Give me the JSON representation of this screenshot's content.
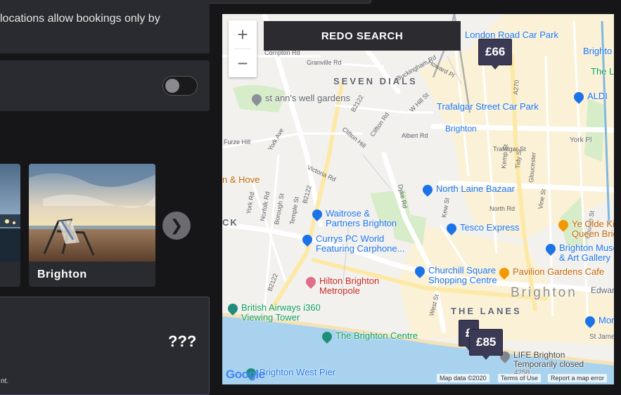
{
  "notice": {
    "text": "locations allow bookings only by"
  },
  "cards": {
    "main_label": "Brighton",
    "next_label": "❯"
  },
  "price_panel": {
    "price": "???",
    "footnote": "nt."
  },
  "map": {
    "redo_label": "REDO SEARCH",
    "zoom_in": "+",
    "zoom_out": "−",
    "pins": [
      "£66",
      "£",
      "£85"
    ],
    "labels": {
      "seven_dials": "SEVEN DIALS",
      "st_anns": "st ann's well gardens",
      "london_road": "London Road Car Park",
      "trafalgar_park": "Trafalgar Street Car Park",
      "brighton_station": "Brighton",
      "north_laine": "North Laine Bazaar",
      "waitrose": "Waitrose &\nPartners Brighton",
      "tesco": "Tesco Express",
      "currys": "Currys PC World\nFeaturing Carphone...",
      "churchill": "Churchill Square\nShopping Centre",
      "hilton": "Hilton Brighton\nMetropole",
      "ba_i360": "British Airways i360\nViewing Tower",
      "brighton_centre": "The Brighton Centre",
      "the_lanes": "THE LANES",
      "brighton_big": "Brighton",
      "museum": "Brighton Museum\n& Art Gallery",
      "ye_olde": "Ye Olde King\nQueen Brigh",
      "pavilion_cafe": "Pavilion Gardens Cafe",
      "hove": "n & Hove",
      "aldi": "ALDI",
      "morris": "Morris",
      "life_brighton": "LIFE Brighton\nTemporarily closed",
      "west_pier": "Brighton West Pier",
      "ck": "CK",
      "brighton_top": "Brighto",
      "the_l": "The L",
      "edward": "Edwar",
      "st_james": "St James'",
      "york_pl": "York Pl",
      "x4258": "4258",
      "streets": {
        "dyke_rd": "Dyke Rd",
        "west_st": "West St",
        "victoria_rd": "Victoria Rd",
        "clifton_hill": "Clifton Hill",
        "b2122a": "B2122",
        "b2122b": "B2122",
        "b2122c": "B2122",
        "furze_hill": "Furze Hill",
        "york_ave": "York Ave",
        "york_rd": "York Rd",
        "norfolk_rd": "Norfolk Rd",
        "borough_st": "Borough St",
        "temple_st": "Temple St",
        "albert_rd": "Albert Rd",
        "clifton_rd": "Clifton Rd",
        "w_hill_st": "W Hill St",
        "buckingham_rd": "Buckingham Rd",
        "howard_pl": "Howard Pl",
        "granville_rd": "Granville Rd",
        "compton_rd": "Compton Rd",
        "a270": "A270",
        "trafalgar_st": "Trafalgar St",
        "north_rd": "North Rd",
        "kew_st": "Kew St",
        "vine_st": "Vine St",
        "kemp_st": "Kemp St",
        "tidy_st": "Tidy St",
        "gloucester": "Gloucester",
        "church_st": "Church St"
      }
    },
    "attribution": {
      "map_data": "Map data ©2020",
      "terms": "Terms of Use",
      "report": "Report a map error",
      "google": "Google"
    }
  }
}
